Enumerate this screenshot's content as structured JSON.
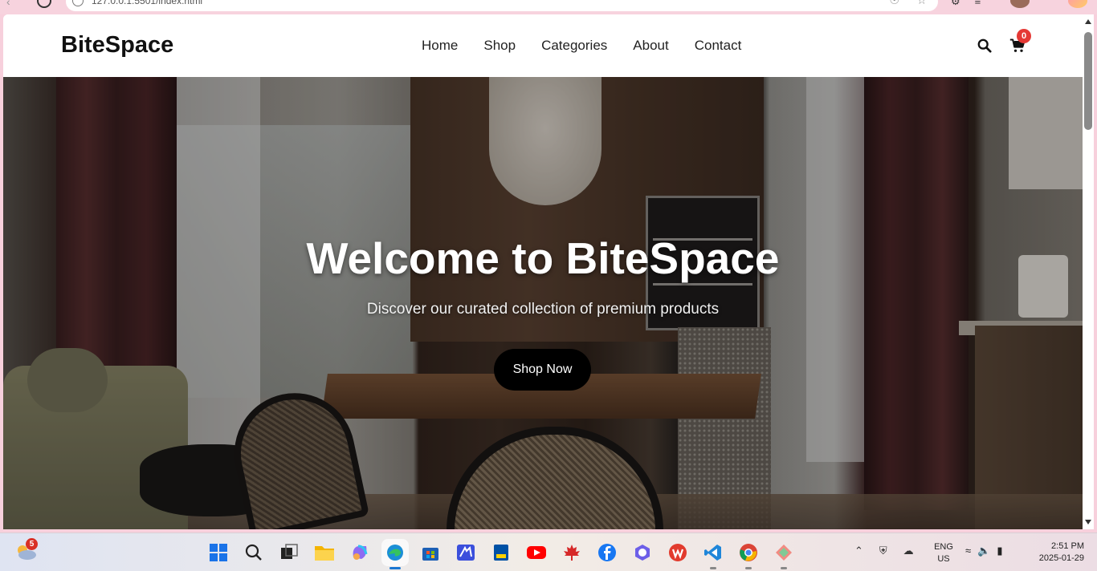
{
  "browser": {
    "url": "127.0.0.1:5501/index.html"
  },
  "site": {
    "logo": "BiteSpace",
    "nav": [
      "Home",
      "Shop",
      "Categories",
      "About",
      "Contact"
    ],
    "cart_count": "0"
  },
  "hero": {
    "title": "Welcome to BiteSpace",
    "subtitle": "Discover our curated collection of premium products",
    "cta_label": "Shop Now"
  },
  "taskbar": {
    "weather_badge": "5",
    "language": "ENG",
    "region": "US",
    "time": "2:51 PM",
    "date": "2025-01-29",
    "pinned_apps": [
      "start",
      "search",
      "task-view",
      "file-explorer",
      "copilot",
      "edge",
      "microsoft-store",
      "visual-studio",
      "rbc",
      "youtube",
      "canada-leaf",
      "facebook",
      "copilot-app",
      "wps-office",
      "vscode",
      "chrome",
      "gemini"
    ]
  },
  "colors": {
    "cart_badge": "#e53935",
    "cta_background": "#000000",
    "weather_badge": "#d93025"
  }
}
